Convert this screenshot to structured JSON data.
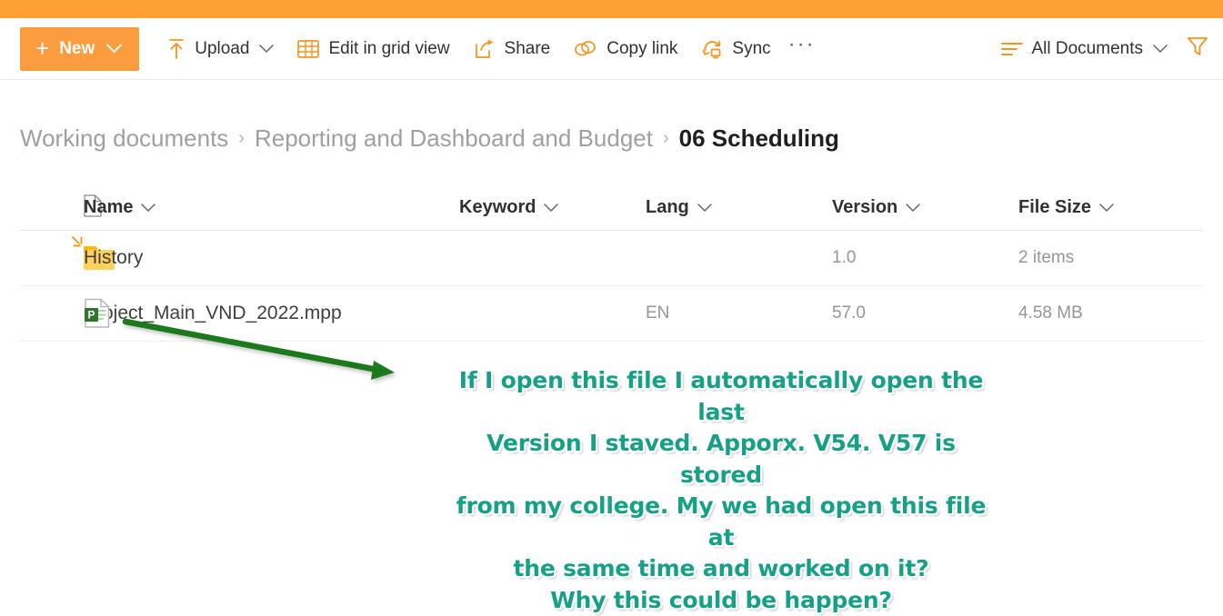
{
  "theme": {
    "accent_orange": "#ff9f33",
    "new_button_bg": "#fb9d3e",
    "icon_orange": "#f7941e",
    "annotation_color": "#16a085",
    "arrow_color": "#1a7a1a",
    "folder_yellow": "#ffd25e",
    "project_green": "#31752f"
  },
  "toolbar": {
    "new_label": "New",
    "new_plus": "+",
    "items": [
      {
        "label": "Upload",
        "icon": "upload-icon",
        "has_chevron": true
      },
      {
        "label": "Edit in grid view",
        "icon": "grid-icon",
        "has_chevron": false
      },
      {
        "label": "Share",
        "icon": "share-icon",
        "has_chevron": false
      },
      {
        "label": "Copy link",
        "icon": "link-icon",
        "has_chevron": false
      },
      {
        "label": "Sync",
        "icon": "sync-icon",
        "has_chevron": false
      }
    ],
    "overflow_label": "···",
    "view_label": "All Documents",
    "view_icon": "list-view-icon",
    "filter_icon": "filter-funnel-icon"
  },
  "breadcrumb": {
    "separator": "›",
    "items": [
      {
        "label": "Working documents",
        "current": false
      },
      {
        "label": "Reporting and Dashboard and Budget",
        "current": false
      },
      {
        "label": "06 Scheduling",
        "current": true
      }
    ]
  },
  "table": {
    "headers": {
      "icon": "",
      "name": "Name",
      "keyword": "Keyword",
      "lang": "Lang",
      "version": "Version",
      "size": "File Size"
    },
    "rows": [
      {
        "icon": "folder-icon",
        "name": "History",
        "badge": "new-burst-icon",
        "keyword": "",
        "lang": "",
        "version": "1.0",
        "size": "2 items"
      },
      {
        "icon": "project-file-icon",
        "name": "Project_Main_VND_2022.mpp",
        "badge": "",
        "keyword": "",
        "lang": "EN",
        "version": "57.0",
        "size": "4.58 MB"
      }
    ]
  },
  "annotation": {
    "text": "If I open this file I automatically open the last\nVersion I staved. Apporx. V54. V57 is stored\nfrom my college. My we had open this file at\nthe same time and worked on it?\nWhy this could be happen?"
  }
}
